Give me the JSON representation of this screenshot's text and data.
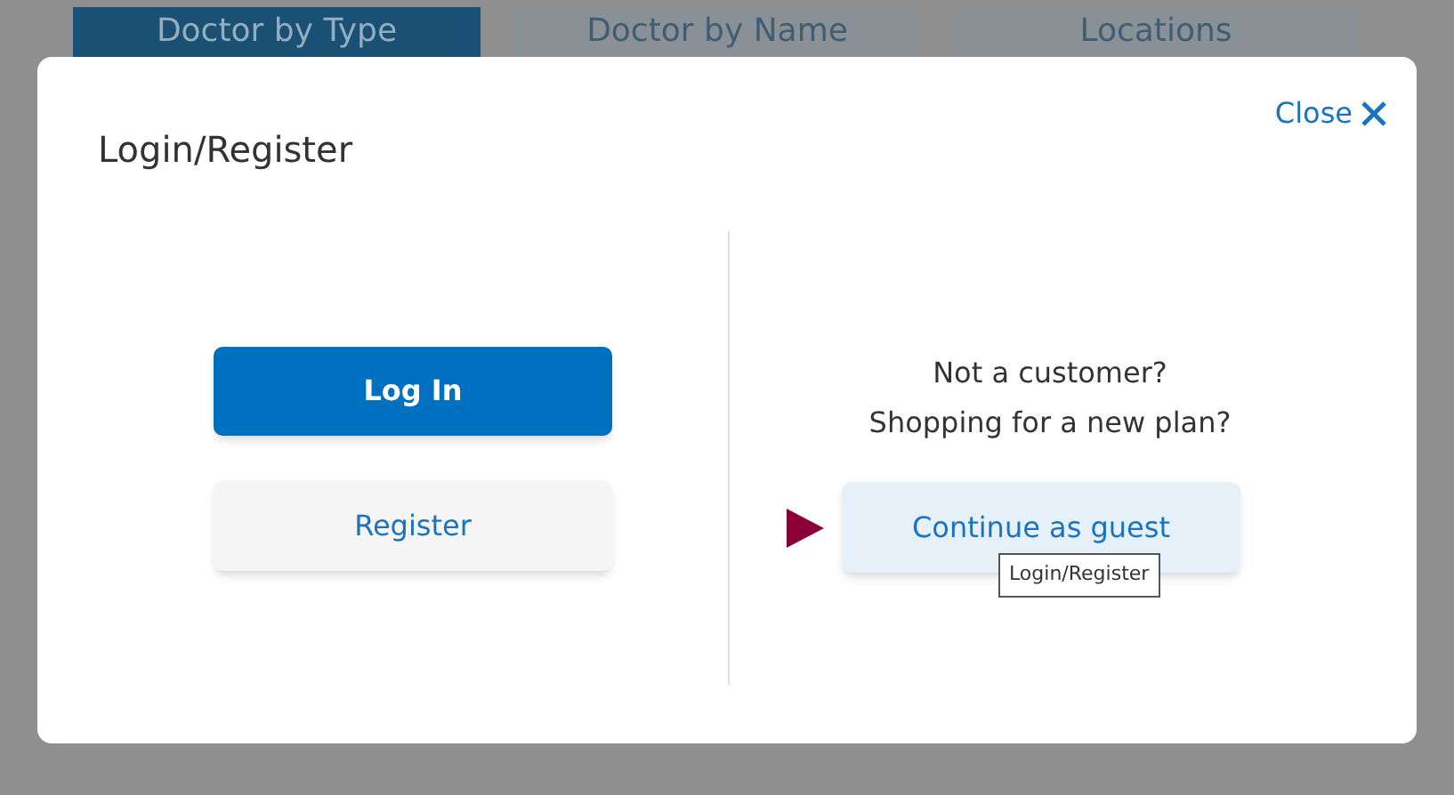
{
  "tabs": [
    {
      "label": "Doctor by Type",
      "selected": true
    },
    {
      "label": "Doctor by Name",
      "selected": false
    },
    {
      "label": "Locations",
      "selected": false
    }
  ],
  "dialog": {
    "title": "Login/Register",
    "close_label": "Close",
    "login_button": "Log In",
    "register_button": "Register",
    "prompt_lines": [
      "Not a customer?",
      "Shopping for a new plan?"
    ],
    "guest_button": "Continue as guest",
    "tooltip": "Login/Register"
  }
}
